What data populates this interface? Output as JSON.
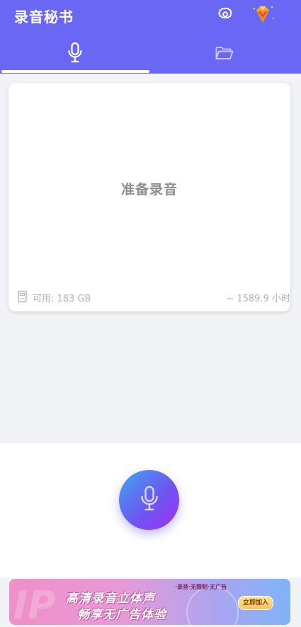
{
  "header": {
    "title": "录音秘书",
    "settings_icon": "settings-gear-icon",
    "vip_icon": "vip-diamond-icon"
  },
  "tabs": [
    {
      "name": "record",
      "icon": "microphone-icon",
      "active": true
    },
    {
      "name": "files",
      "icon": "folder-icon",
      "active": false
    }
  ],
  "card": {
    "status": "准备录音",
    "storage_icon": "storage-icon",
    "available_storage": "可用: 183 GB",
    "remaining_time": "~ 1589.9 小时"
  },
  "record_button": {
    "icon": "microphone-icon"
  },
  "banner": {
    "line1": "高清录音立体声",
    "line2": "畅享无广告体验",
    "tags": "·录音·无限制·无广告",
    "join_label": "立即加入",
    "watermark": "IP"
  },
  "colors": {
    "header_bg": "#6a67f5",
    "page_bg": "#f2f3f6",
    "mic_gradient_start": "#3fa6f3",
    "mic_gradient_end": "#a02ef6"
  }
}
